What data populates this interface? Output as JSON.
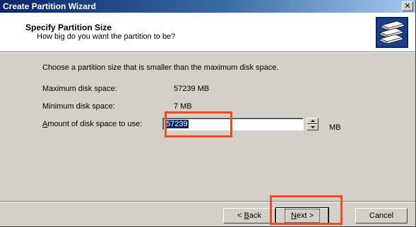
{
  "window": {
    "title": "Create Partition Wizard",
    "close_glyph": "✕"
  },
  "header": {
    "title": "Specify Partition Size",
    "subtitle": "How big do you want the partition to be?",
    "icon": "disk-stack-icon"
  },
  "body": {
    "instruction": "Choose a partition size that is smaller than the maximum disk space.",
    "max_label": "Maximum disk space:",
    "max_value": "57239 MB",
    "min_label": "Minimum disk space:",
    "min_value": "7 MB",
    "amount_label_accel": "A",
    "amount_label_rest": "mount of disk space to use:",
    "amount_value": "57239",
    "amount_unit": "MB"
  },
  "buttons": {
    "back_prefix": "< ",
    "back_accel": "B",
    "back_rest": "ack",
    "next_accel": "N",
    "next_rest": "ext >",
    "cancel": "Cancel"
  },
  "colors": {
    "highlight": "#f24a1f",
    "titlebar_start": "#0a246a",
    "titlebar_end": "#a6caf0",
    "dialog_face": "#d4d0c8"
  }
}
